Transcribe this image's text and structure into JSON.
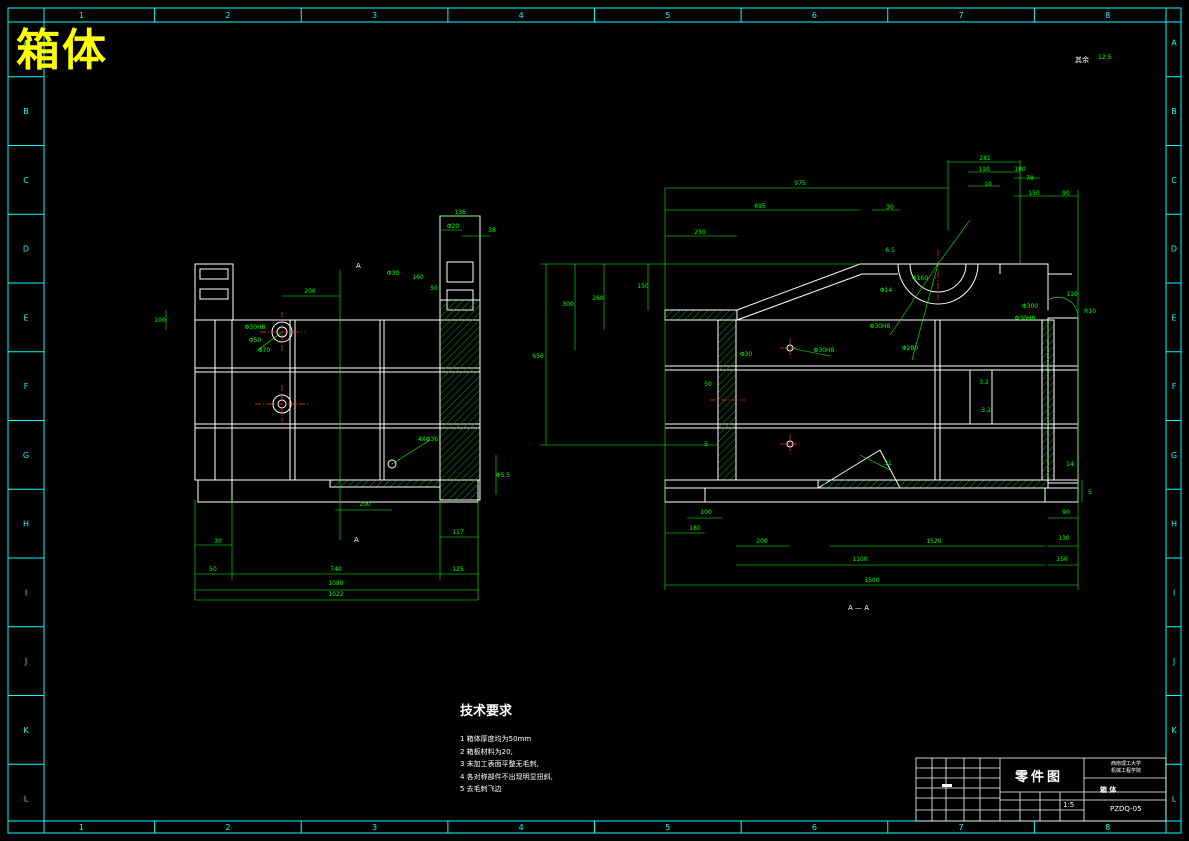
{
  "title": "箱体",
  "frame": {
    "columns": [
      "1",
      "2",
      "3",
      "4",
      "5",
      "6",
      "7",
      "8"
    ],
    "rows": [
      "A",
      "B",
      "C",
      "D",
      "E",
      "F",
      "G",
      "H",
      "I",
      "J",
      "K",
      "L"
    ]
  },
  "roughness": {
    "label": "其余",
    "value": "12.5"
  },
  "section_label": "A — A",
  "cut_mark": "A",
  "left_view_dims": [
    "136",
    "Φ20",
    "38",
    "Φ30",
    "160",
    "50",
    "200",
    "100",
    "Φ30H8",
    "Φ50",
    "Φ70",
    "4XΦ36",
    "Φ5.5",
    "200",
    "117",
    "30",
    "740",
    "125",
    "50",
    "1080",
    "1022"
  ],
  "right_view_dims": [
    "281",
    "110",
    "180",
    "10",
    "78",
    "150",
    "90",
    "975",
    "695",
    "30",
    "250",
    "6.5",
    "300",
    "260",
    "150",
    "650",
    "Φ14",
    "Φ160",
    "Φ30H8",
    "Φ280",
    "Φ300",
    "Φ30H8",
    "Φ30H8",
    "110",
    "R10",
    "5",
    "3.2",
    "3.2",
    "50",
    "Φ30",
    "14",
    "31",
    "5",
    "180",
    "100",
    "200",
    "1520",
    "1100",
    "130",
    "150",
    "1500",
    "90"
  ],
  "tech_requirements": {
    "heading": "技术要求",
    "items": [
      "1 箱体厚度均为50mm",
      "2 箱板材料为20,",
      "3 未加工表面平整无毛刺,",
      "4 各对称部件不出现明显扭斜,",
      "5 去毛刺飞边"
    ]
  },
  "title_block": {
    "part_label": "零件图",
    "school": [
      "西南理工大学",
      "机械工程学院"
    ],
    "name": "箱 体",
    "scale": "1:5",
    "code": "PZDQ-05"
  },
  "colors": {
    "frame": "#00ffff",
    "outline": "#ffffff",
    "dimension": "#00ff00",
    "title": "#ffff00",
    "hatch": "#00a000",
    "center": "#ff3030"
  }
}
